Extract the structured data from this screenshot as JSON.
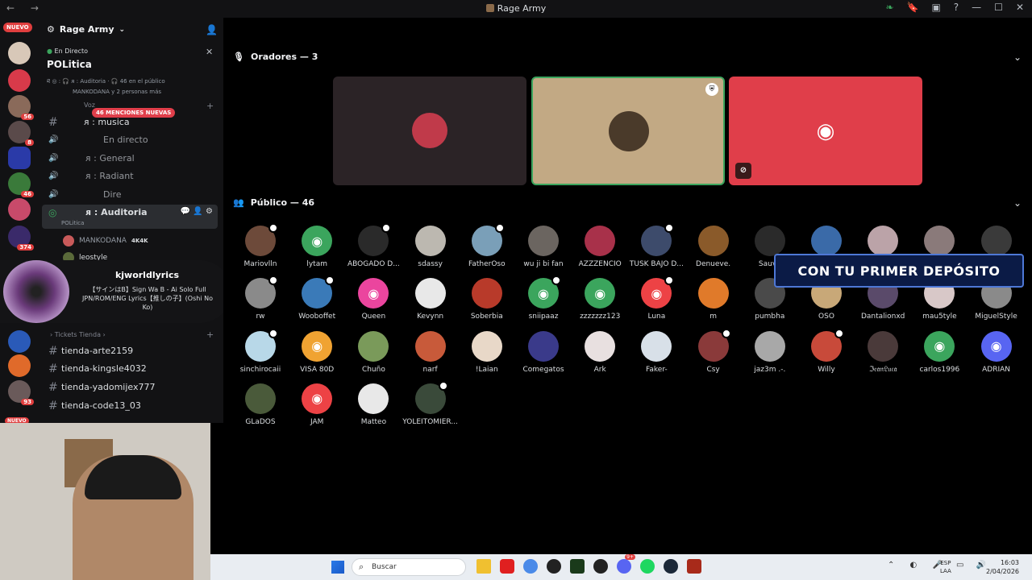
{
  "titlebar": {
    "title": "Rage Army",
    "nav": "← →"
  },
  "server": {
    "name": "Rage Army",
    "new_label": "NUEVO",
    "badges": [
      "56",
      "8",
      "46",
      "374",
      "93"
    ],
    "bottom_new": "NUEVO"
  },
  "live": {
    "status": "En Directo",
    "title": "POLitica",
    "line1": "ཐ ◎ : 🎧 ᴙ : Auditoria · 🎧 46 en el público",
    "line2": "MANKODANA y 2 personas más"
  },
  "channels": {
    "voice_label": "Voz",
    "mentions": "46 MENCIONES NUEVAS",
    "items": [
      {
        "name": "ᴙ : musica",
        "icon": "#"
      },
      {
        "name": "En directo",
        "icon": "🔊"
      },
      {
        "name": "ᴙ : General",
        "icon": "🔊"
      },
      {
        "name": "ᴙ : Radiant",
        "icon": "🔊"
      },
      {
        "name": "Dire",
        "icon": "🔊"
      },
      {
        "name": "ᴙ : Auditoria",
        "icon": "🔊"
      }
    ],
    "auditoria_sub": "POLitica",
    "voice_users": [
      {
        "name": "MANKODANA",
        "tag": "4K4K"
      },
      {
        "name": "leostyle"
      }
    ],
    "tickets_label": "Tickets Tienda",
    "tickets": [
      "tienda-arte2159",
      "tienda-kingsle4032",
      "tienda-yadomijex777",
      "tienda-code13_03"
    ]
  },
  "music": {
    "artist": "kjworldlyrics",
    "track": "【サインはB】Sign Wa B - Ai Solo Full JPN/ROM/ENG Lyrics【推しの子】(Oshi No Ko)"
  },
  "stage": {
    "speakers_label": "Oradores — 3",
    "public_label": "Público — 46"
  },
  "audience": [
    {
      "name": "Mariovlln",
      "color": "#6d4a3a",
      "mod": true
    },
    {
      "name": "lytam",
      "color": "#3ba55d",
      "discord": true
    },
    {
      "name": "ABOGADO D...",
      "color": "#2a2a2a",
      "mod": true
    },
    {
      "name": "sdassy",
      "color": "#bcb8b0"
    },
    {
      "name": "FatherOso",
      "color": "#7a9fb8",
      "mod": true
    },
    {
      "name": "wu ji bi fan",
      "color": "#6b6560"
    },
    {
      "name": "AZZZENCIO",
      "color": "#a8314a"
    },
    {
      "name": "TUSK BAJO D...",
      "color": "#3d4b6b",
      "mod": true
    },
    {
      "name": "Denueve.",
      "color": "#8a5a2a"
    },
    {
      "name": "Sauve",
      "color": "#2a2a2a"
    },
    {
      "name": "",
      "color": "#3a6aa8"
    },
    {
      "name": "",
      "color": "#bba3a8"
    },
    {
      "name": "",
      "color": "#8a7a7a"
    },
    {
      "name": "",
      "color": "#3a3a3a"
    },
    {
      "name": "rw",
      "color": "#8a8a8a",
      "mod": true
    },
    {
      "name": "Wooboffet",
      "color": "#3a7ab8",
      "mod": true
    },
    {
      "name": "Queen",
      "color": "#eb459e",
      "discord": true
    },
    {
      "name": "Kevynn",
      "color": "#e8e8e8"
    },
    {
      "name": "Soberbia",
      "color": "#b83a2a"
    },
    {
      "name": "sniipaaz",
      "color": "#3ba55d",
      "discord": true,
      "mod": true
    },
    {
      "name": "zzzzzzz123",
      "color": "#3ba55d",
      "discord": true
    },
    {
      "name": "Luna",
      "color": "#ed4245",
      "discord": true,
      "mod": true
    },
    {
      "name": "m",
      "color": "#e07a2a"
    },
    {
      "name": "pumbha",
      "color": "#4a4a4a"
    },
    {
      "name": "OSO",
      "color": "#c8a878"
    },
    {
      "name": "Dantalionxd",
      "color": "#5a4a6a"
    },
    {
      "name": "mau5tyle",
      "color": "#d8c8c8"
    },
    {
      "name": "MiguelStyle",
      "color": "#8a8a8a"
    },
    {
      "name": "sinchirocaii",
      "color": "#b8d8e8",
      "mod": true
    },
    {
      "name": "VISA 80D",
      "color": "#f0a332",
      "discord": true
    },
    {
      "name": "Chuño",
      "color": "#7a9a5a"
    },
    {
      "name": "narf",
      "color": "#c85a3a"
    },
    {
      "name": "!Laian",
      "color": "#e8d8c8"
    },
    {
      "name": "Comegatos",
      "color": "#3a3a8a"
    },
    {
      "name": "Ark",
      "color": "#e8e0e0"
    },
    {
      "name": "Faker-",
      "color": "#d8e0e8"
    },
    {
      "name": "Csy",
      "color": "#8a3a3a",
      "mod": true
    },
    {
      "name": "jaz3m .-.",
      "color": "#a8a8a8"
    },
    {
      "name": "Willy",
      "color": "#c84a3a",
      "mod": true
    },
    {
      "name": "ℑ𝔢𝔞𝔫𝔏𝔲𝔠𝔞",
      "color": "#4a3a3a"
    },
    {
      "name": "carlos1996",
      "color": "#3ba55d",
      "discord": true
    },
    {
      "name": "ADRIAN",
      "color": "#5865f2",
      "discord": true
    },
    {
      "name": "GLaDOS",
      "color": "#4a5a3a"
    },
    {
      "name": "JAM",
      "color": "#ed4245",
      "discord": true
    },
    {
      "name": "Matteo",
      "color": "#e8e8e8"
    },
    {
      "name": "YOLEITOMIER...",
      "color": "#3a4a3a",
      "mod": true
    }
  ],
  "promo": {
    "text": "CON TU PRIMER DEPÓSITO"
  },
  "taskbar": {
    "search_placeholder": "Buscar",
    "lang": "ESP",
    "lang2": "LAA",
    "time": "16:03",
    "date": "2/04/2026",
    "discord_badge": "9+"
  },
  "colors": {
    "discord_red": "#e03e4a",
    "speaker_tan": "#c2a984",
    "bg": "#000000",
    "sidebar": "#121214"
  }
}
